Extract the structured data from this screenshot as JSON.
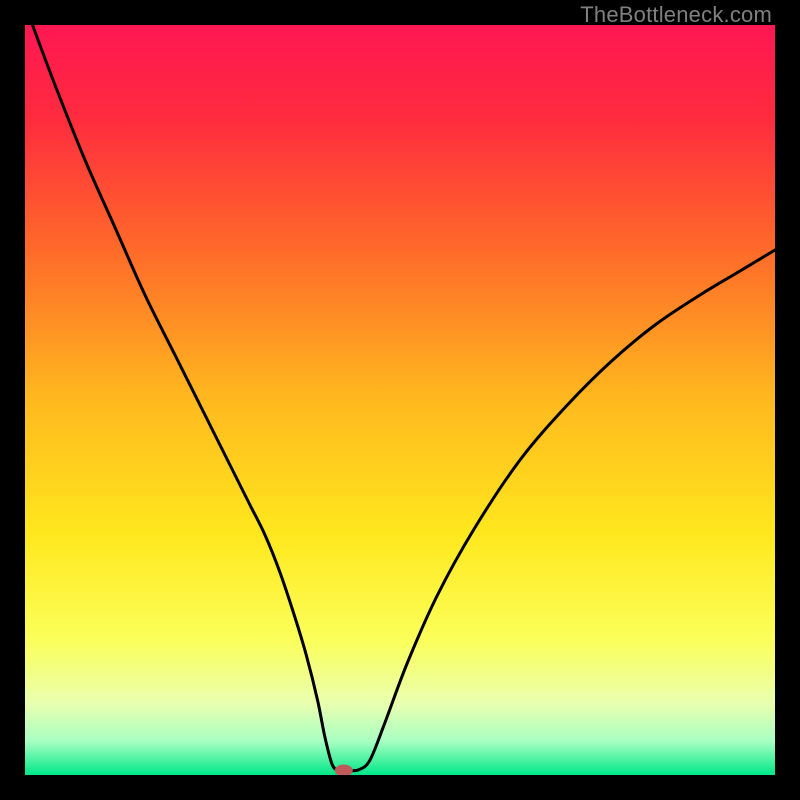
{
  "watermark": "TheBottleneck.com",
  "chart_data": {
    "type": "line",
    "title": "",
    "xlabel": "",
    "ylabel": "",
    "xlim": [
      0,
      100
    ],
    "ylim": [
      0,
      100
    ],
    "background_gradient_stops": [
      {
        "offset": 0.0,
        "color": "#ff1752"
      },
      {
        "offset": 0.12,
        "color": "#ff2a3f"
      },
      {
        "offset": 0.3,
        "color": "#ff6a2a"
      },
      {
        "offset": 0.5,
        "color": "#ffb91e"
      },
      {
        "offset": 0.68,
        "color": "#ffe81e"
      },
      {
        "offset": 0.82,
        "color": "#fbff5a"
      },
      {
        "offset": 0.905,
        "color": "#e9ffb0"
      },
      {
        "offset": 0.955,
        "color": "#a8ffc2"
      },
      {
        "offset": 1.0,
        "color": "#00e888"
      }
    ],
    "series": [
      {
        "name": "bottleneck-curve",
        "x": [
          1,
          4,
          8,
          12,
          16,
          20,
          24,
          28,
          30,
          32,
          34,
          36,
          37.5,
          39,
          40,
          41,
          42,
          43,
          44.5,
          46,
          48,
          51,
          55,
          60,
          66,
          72,
          78,
          84,
          90,
          95,
          100
        ],
        "y": [
          100,
          92,
          82,
          73,
          64,
          56,
          48,
          40,
          36,
          32,
          27,
          21,
          16,
          10,
          5,
          1.3,
          0.6,
          0.6,
          0.7,
          2,
          7,
          15,
          24,
          33,
          42,
          49,
          55,
          60,
          64,
          67,
          70
        ]
      }
    ],
    "marker": {
      "name": "bottleneck-marker",
      "x": 42.5,
      "y": 0.6,
      "color": "#c05a5a",
      "rx": 9,
      "ry": 6
    }
  }
}
